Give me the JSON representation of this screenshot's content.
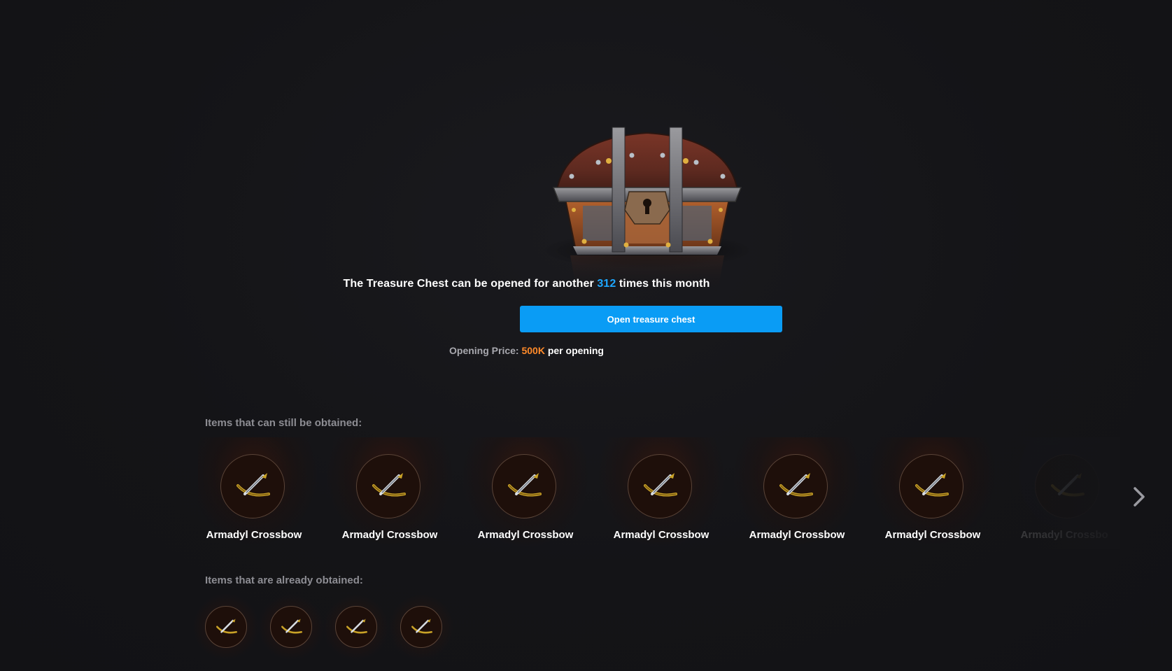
{
  "chest": {
    "message_prefix": "The Treasure Chest can be opened for another",
    "remaining_count": "312",
    "message_suffix": "times this month",
    "open_button_label": "Open treasure chest",
    "price_label": "Opening Price:",
    "price_amount": "500K",
    "price_suffix": "per opening"
  },
  "available": {
    "title": "Items that can still be obtained:",
    "items": [
      {
        "name": "Armadyl Crossbow",
        "icon": "crossbow-icon"
      },
      {
        "name": "Armadyl Crossbow",
        "icon": "crossbow-icon"
      },
      {
        "name": "Armadyl Crossbow",
        "icon": "crossbow-icon"
      },
      {
        "name": "Armadyl Crossbow",
        "icon": "crossbow-icon"
      },
      {
        "name": "Armadyl Crossbow",
        "icon": "crossbow-icon"
      },
      {
        "name": "Armadyl Crossbow",
        "icon": "crossbow-icon"
      },
      {
        "name": "Armadyl Crossbow",
        "icon": "crossbow-icon"
      }
    ],
    "next_icon": "chevron-right-icon"
  },
  "obtained": {
    "title": "Items that are already obtained:",
    "items": [
      {
        "icon": "crossbow-icon"
      },
      {
        "icon": "crossbow-icon"
      },
      {
        "icon": "crossbow-icon"
      },
      {
        "icon": "crossbow-icon"
      }
    ]
  },
  "colors": {
    "background": "#141417",
    "accent_blue": "#0a9cf5",
    "count_blue": "#1ea7ff",
    "price_orange": "#ff8a2a",
    "muted_text": "#8d8d93"
  }
}
